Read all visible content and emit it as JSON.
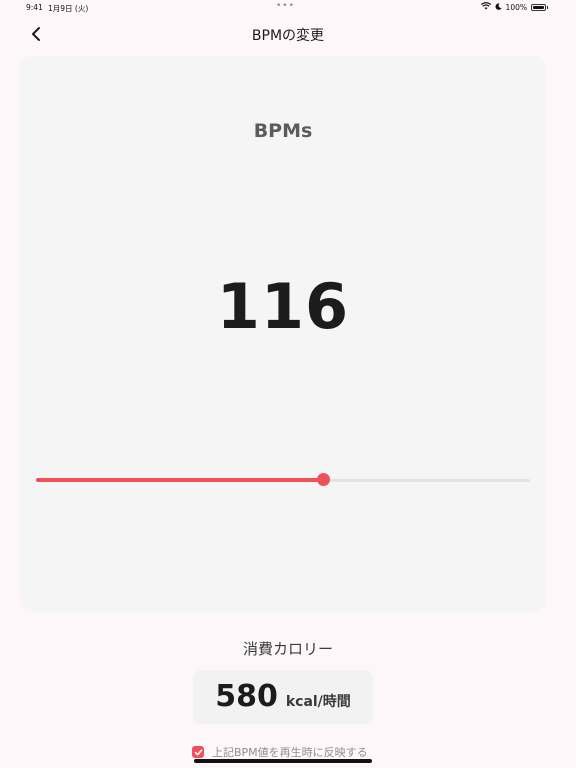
{
  "status_bar": {
    "time": "9:41",
    "date": "1月9日 (火)",
    "more": "•••",
    "battery": "100%"
  },
  "nav": {
    "back_icon": "chevron-left-icon",
    "title": "BPMの変更"
  },
  "bpm_card": {
    "label": "BPMs",
    "value": "116",
    "slider_fraction": 0.58
  },
  "calories": {
    "label": "消費カロリー",
    "value": "580",
    "unit": "kcal/時間"
  },
  "reflect_option": {
    "checked": true,
    "label": "上記BPM値を再生時に反映する"
  },
  "colors": {
    "accent": "#f0505b",
    "background": "#fdf7fa",
    "card": "#f5f5f5"
  }
}
